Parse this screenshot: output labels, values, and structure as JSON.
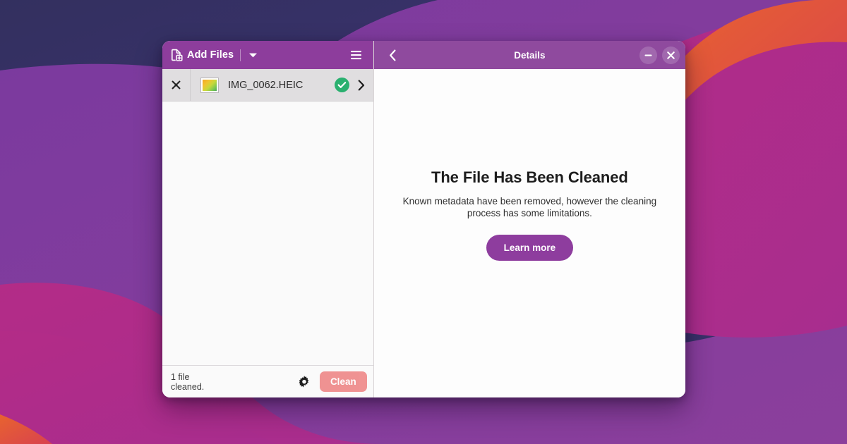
{
  "window": {
    "left_panel": {
      "headerbar": {
        "add_files_label": "Add Files",
        "add_files_icon": "document-add-icon",
        "dropdown_icon": "chevron-down-icon",
        "menu_icon": "hamburger-menu-icon"
      },
      "files": [
        {
          "remove_icon": "close-icon",
          "thumbnail_icon": "image-thumbnail-icon",
          "name": "IMG_0062.HEIC",
          "status_icon": "check-circle-icon",
          "status": "cleaned",
          "open_icon": "chevron-right-icon"
        }
      ],
      "statusbar": {
        "status_text": "1 file\ncleaned.",
        "settings_icon": "gear-icon",
        "clean_label": "Clean",
        "clean_enabled": false
      }
    },
    "right_panel": {
      "headerbar": {
        "back_icon": "chevron-left-icon",
        "title": "Details",
        "minimize_icon": "minimize-icon",
        "close_icon": "close-icon"
      },
      "content": {
        "title": "The File Has Been Cleaned",
        "description": "Known metadata have been removed, however the cleaning process has some limitations.",
        "learn_more_label": "Learn more"
      }
    }
  },
  "colors": {
    "headerbar_left": "#8d3d9c",
    "headerbar_right": "#8f4a9e",
    "accent": "#8e3d9e",
    "clean_button": "#ef8a8a",
    "success": "#2ab06f",
    "panel_background": "#fdfdfd",
    "list_background": "#fafafa",
    "row_selected": "#e0dee0"
  }
}
